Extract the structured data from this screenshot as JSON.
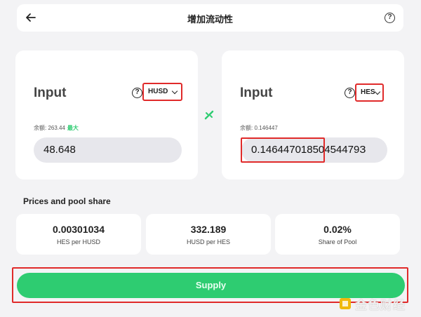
{
  "header": {
    "title": "增加流动性",
    "help_icon": "question-circle-icon",
    "back_icon": "arrow-left-icon"
  },
  "left_panel": {
    "label": "Input",
    "token": "HUSD",
    "balance_label": "余额: 263.44",
    "max_label": "最大",
    "amount": "48.648"
  },
  "right_panel": {
    "label": "Input",
    "token": "HES",
    "balance_label": "余额: 0.146447",
    "amount": "0.14644701850454479З"
  },
  "link_icon": "link-icon",
  "pool": {
    "title": "Prices and pool share",
    "stats": [
      {
        "value": "0.00301034",
        "label": "HES per HUSD"
      },
      {
        "value": "332.189",
        "label": "HUSD per HES"
      },
      {
        "value": "0.02%",
        "label": "Share of Pool"
      }
    ]
  },
  "supply_label": "Supply",
  "watermark": {
    "text": "金色财经"
  },
  "colors": {
    "accent": "#2ecc71",
    "highlight": "#e02a2a",
    "background": "#f3f3f5"
  }
}
